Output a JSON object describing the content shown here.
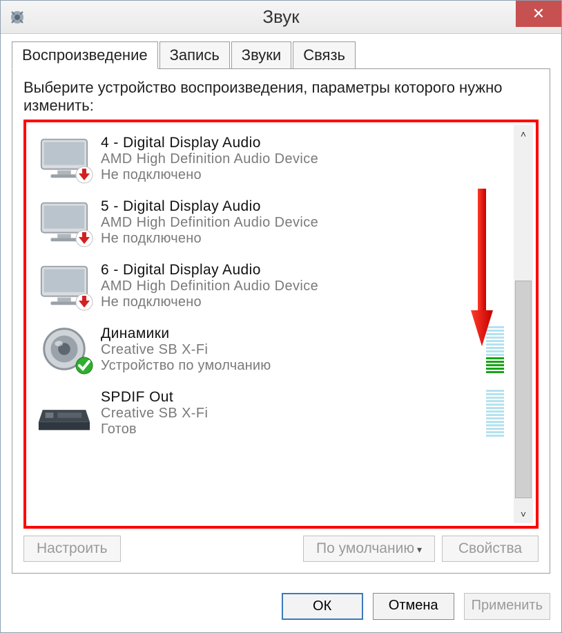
{
  "window": {
    "title": "Звук",
    "close_label": "✕"
  },
  "tabs": [
    {
      "label": "Воспроизведение",
      "active": true
    },
    {
      "label": "Запись",
      "active": false
    },
    {
      "label": "Звуки",
      "active": false
    },
    {
      "label": "Связь",
      "active": false
    }
  ],
  "instruction": "Выберите устройство воспроизведения, параметры которого нужно изменить:",
  "devices": [
    {
      "icon": "monitor",
      "badge": "down-red",
      "name": "4 - Digital Display Audio",
      "sub": "AMD High Definition Audio Device",
      "status": "Не подключено",
      "meter": null
    },
    {
      "icon": "monitor",
      "badge": "down-red",
      "name": "5 - Digital Display Audio",
      "sub": "AMD High Definition Audio Device",
      "status": "Не подключено",
      "meter": null
    },
    {
      "icon": "monitor",
      "badge": "down-red",
      "name": "6 - Digital Display Audio",
      "sub": "AMD High Definition Audio Device",
      "status": "Не подключено",
      "meter": null
    },
    {
      "icon": "speaker",
      "badge": "check-green",
      "name": "Динамики",
      "sub": "Creative SB X-Fi",
      "status": "Устройство по умолчанию",
      "meter": {
        "total": 14,
        "on": 5
      }
    },
    {
      "icon": "spdif",
      "badge": null,
      "name": "SPDIF Out",
      "sub": "Creative SB X-Fi",
      "status": "Готов",
      "meter": {
        "total": 14,
        "on": 0
      }
    }
  ],
  "panel_buttons": {
    "configure": "Настроить",
    "set_default": "По умолчанию",
    "properties": "Свойства"
  },
  "dialog_buttons": {
    "ok": "ОК",
    "cancel": "Отмена",
    "apply": "Применить"
  }
}
